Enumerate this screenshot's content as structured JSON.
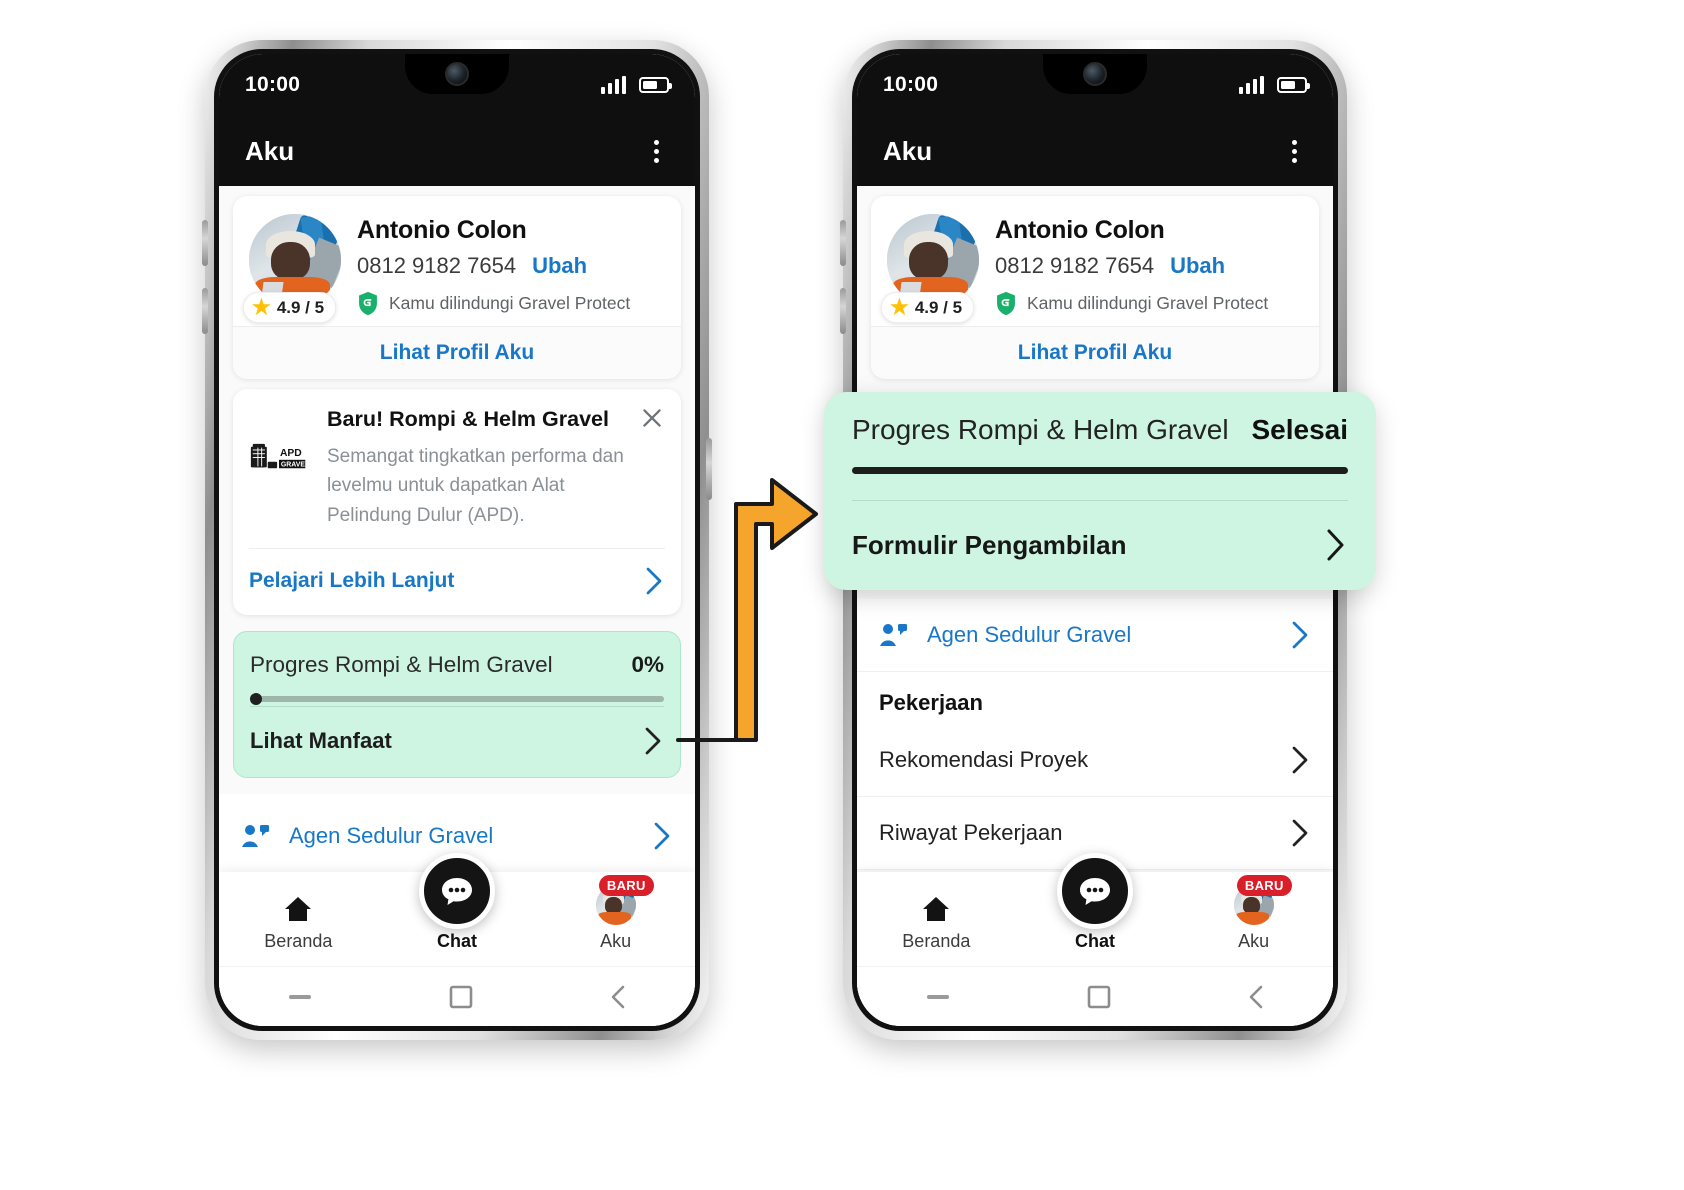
{
  "status_bar": {
    "time": "10:00",
    "signal_icon": "signal-bars-icon",
    "battery_icon": "battery-icon"
  },
  "app_bar": {
    "title": "Aku",
    "menu_icon": "kebab-menu-icon"
  },
  "profile": {
    "name": "Antonio Colon",
    "phone": "0812 9182 7654",
    "edit_label": "Ubah",
    "rating": "4.9 / 5",
    "star_icon": "star-icon",
    "shield_icon": "gravel-protect-shield-icon",
    "protect_text": "Kamu dilindungi Gravel Protect",
    "view_profile": "Lihat Profil Aku"
  },
  "promo": {
    "title": "Baru! Rompi & Helm Gravel",
    "description": "Semangat tingkatkan performa dan levelmu untuk dapatkan Alat Pelindung Dulur (APD).",
    "badge_line1": "APD",
    "badge_line2": "GRAVEL",
    "cta": "Pelajari Lebih Lanjut",
    "close_icon": "close-icon",
    "chevron_icon": "chevron-right-icon"
  },
  "progress_card": {
    "title": "Progres Rompi & Helm Gravel",
    "percent_label": "0%",
    "percent_value": 0,
    "action": "Lihat Manfaat",
    "chevron_icon": "chevron-right-icon"
  },
  "callout": {
    "title": "Progres Rompi & Helm Gravel",
    "status": "Selesai",
    "percent_value": 100,
    "action": "Formulir Pengambilan",
    "chevron_icon": "chevron-right-icon"
  },
  "menu_rows": {
    "agen": {
      "label": "Agen Sedulur Gravel",
      "icon": "people-icon",
      "chevron_icon": "chevron-right-icon"
    },
    "section_title": "Pekerjaan",
    "items": [
      {
        "label": "Rekomendasi Proyek",
        "chevron_icon": "chevron-right-icon"
      },
      {
        "label": "Riwayat Pekerjaan",
        "chevron_icon": "chevron-right-icon"
      }
    ]
  },
  "bottom_nav": {
    "items": [
      {
        "label": "Beranda",
        "icon": "home-icon"
      },
      {
        "label": "Chat",
        "icon": "chat-bubble-icon"
      },
      {
        "label": "Aku",
        "icon": "avatar-icon",
        "badge": "BARU"
      }
    ],
    "active": "Chat"
  },
  "system_nav": {
    "recent_icon": "recents-icon",
    "home_icon": "square-home-icon",
    "back_icon": "back-chevron-icon"
  },
  "colors": {
    "accent_green": "#cdf5e2",
    "link_blue": "#1878c7",
    "badge_red": "#d81f2a",
    "arrow_orange": "#f6a52c",
    "dark": "#0f0f0f"
  },
  "connector": {
    "arrow_icon": "flow-arrow-right-icon"
  }
}
